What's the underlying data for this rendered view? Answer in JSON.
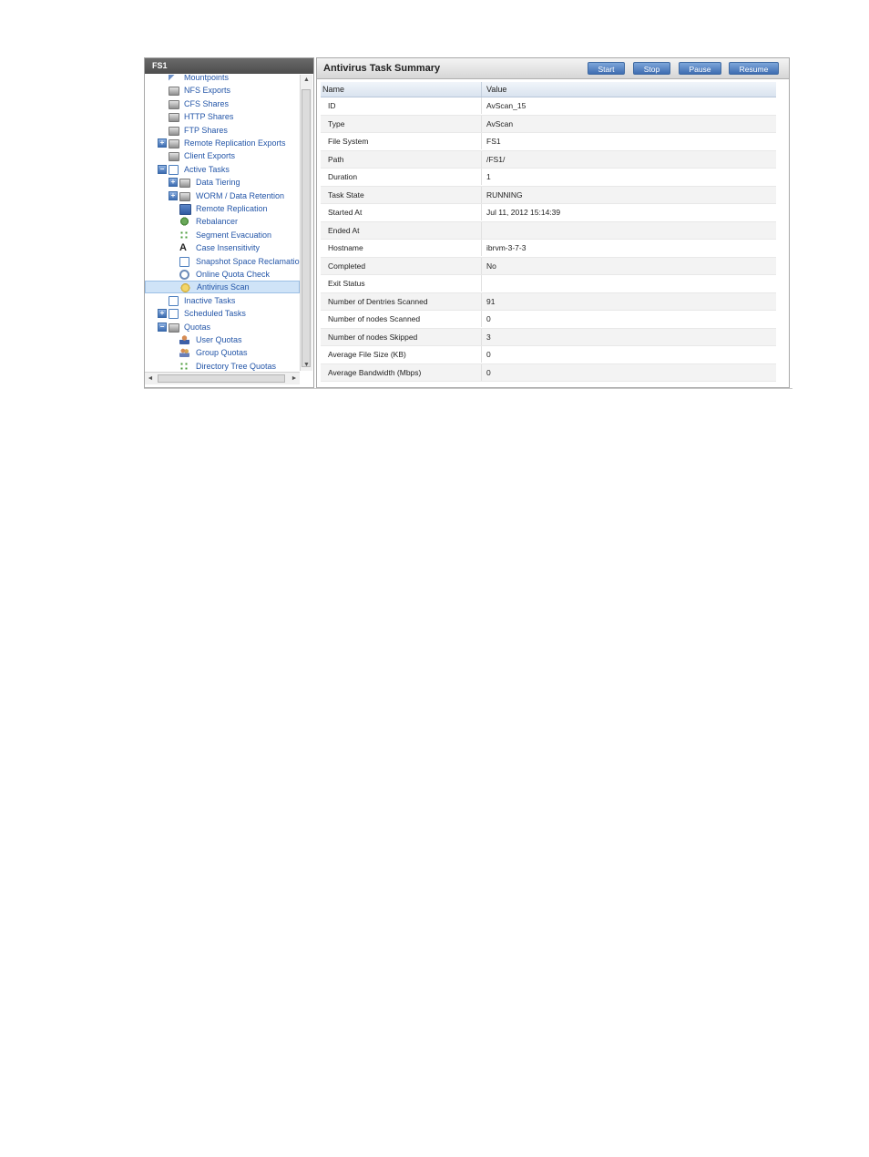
{
  "tree": {
    "header": "FS1",
    "items": [
      {
        "label": "Mountpoints",
        "icon": "wrench-icon"
      },
      {
        "label": "NFS Exports",
        "icon": "drive-icon"
      },
      {
        "label": "CFS Shares",
        "icon": "drive-icon"
      },
      {
        "label": "HTTP Shares",
        "icon": "drive-icon"
      },
      {
        "label": "FTP Shares",
        "icon": "drive-icon"
      },
      {
        "label": "Remote Replication Exports",
        "icon": "drive-icon",
        "expander": "+"
      },
      {
        "label": "Client Exports",
        "icon": "drive-icon"
      },
      {
        "label": "Active Tasks",
        "icon": "document-icon",
        "expander": "−"
      },
      {
        "label": "Data Tiering",
        "icon": "drive-icon",
        "expander": "+"
      },
      {
        "label": "WORM / Data Retention",
        "icon": "drive-icon",
        "expander": "+"
      },
      {
        "label": "Remote Replication",
        "icon": "replication-icon"
      },
      {
        "label": "Rebalancer",
        "icon": "gear-icon"
      },
      {
        "label": "Segment Evacuation",
        "icon": "dots-icon"
      },
      {
        "label": "Case Insensitivity",
        "icon": "font-icon"
      },
      {
        "label": "Snapshot Space Reclamation",
        "icon": "document-icon"
      },
      {
        "label": "Online Quota Check",
        "icon": "magnifier-icon"
      },
      {
        "label": "Antivirus Scan",
        "icon": "antivirus-icon",
        "selected": true
      },
      {
        "label": "Inactive Tasks",
        "icon": "document-icon"
      },
      {
        "label": "Scheduled Tasks",
        "icon": "document-icon",
        "expander": "+"
      },
      {
        "label": "Quotas",
        "icon": "drive-icon",
        "expander": "−"
      },
      {
        "label": "User Quotas",
        "icon": "user-icon"
      },
      {
        "label": "Group Quotas",
        "icon": "group-icon"
      },
      {
        "label": "Directory Tree Quotas",
        "icon": "dots-icon"
      }
    ]
  },
  "summary": {
    "title": "Antivirus Task Summary",
    "buttons": {
      "start": "Start",
      "stop": "Stop",
      "pause": "Pause",
      "resume": "Resume"
    },
    "columns": {
      "name": "Name",
      "value": "Value"
    },
    "rows": [
      {
        "name": "ID",
        "value": "AvScan_15"
      },
      {
        "name": "Type",
        "value": "AvScan"
      },
      {
        "name": "File System",
        "value": "FS1"
      },
      {
        "name": "Path",
        "value": "/FS1/"
      },
      {
        "name": "Duration",
        "value": "1"
      },
      {
        "name": "Task State",
        "value": "RUNNING"
      },
      {
        "name": "Started At",
        "value": "Jul 11, 2012 15:14:39"
      },
      {
        "name": "Ended At",
        "value": ""
      },
      {
        "name": "Hostname",
        "value": "ibrvm-3-7-3"
      },
      {
        "name": "Completed",
        "value": "No"
      },
      {
        "name": "Exit Status",
        "value": ""
      },
      {
        "name": "Number of Dentries Scanned",
        "value": "91"
      },
      {
        "name": "Number of nodes Scanned",
        "value": "0"
      },
      {
        "name": "Number of nodes Skipped",
        "value": "3"
      },
      {
        "name": "Average File Size (KB)",
        "value": "0"
      },
      {
        "name": "Average Bandwidth (Mbps)",
        "value": "0"
      }
    ]
  }
}
